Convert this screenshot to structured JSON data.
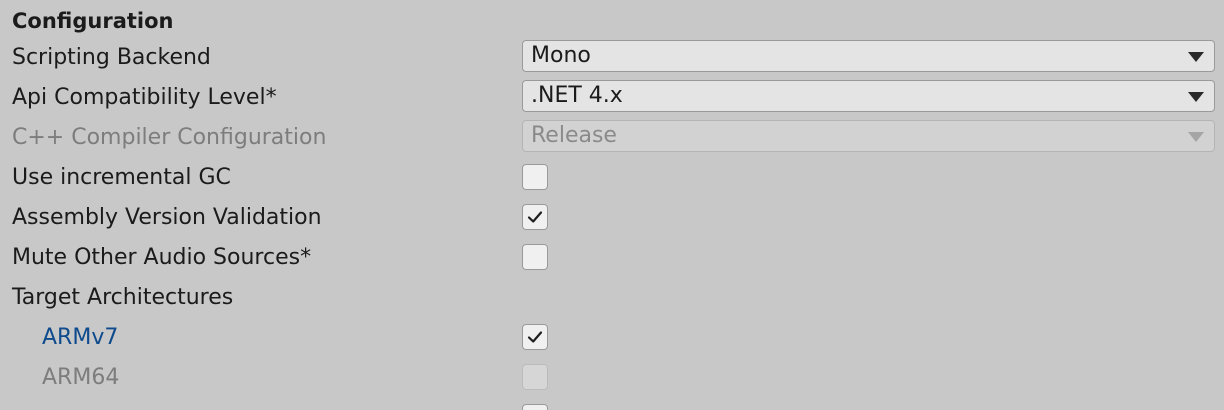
{
  "section": {
    "title": "Configuration"
  },
  "rows": {
    "scripting_backend": {
      "label": "Scripting Backend",
      "value": "Mono"
    },
    "api_compat": {
      "label": "Api Compatibility Level*",
      "value": ".NET 4.x"
    },
    "cpp_compiler": {
      "label": "C++ Compiler Configuration",
      "value": "Release"
    },
    "incremental_gc": {
      "label": "Use incremental GC",
      "checked": false
    },
    "assembly_validation": {
      "label": "Assembly Version Validation",
      "checked": true
    },
    "mute_audio": {
      "label": "Mute Other Audio Sources*",
      "checked": false
    },
    "target_arch": {
      "label": "Target Architectures"
    },
    "armv7": {
      "label": "ARMv7",
      "checked": true
    },
    "arm64": {
      "label": "ARM64",
      "checked": false
    }
  },
  "colors": {
    "background": "#c8c8c8",
    "text": "#1b1b1b",
    "disabled_text": "#7d7d7d",
    "prefab_override_text": "#0e4a8c"
  }
}
